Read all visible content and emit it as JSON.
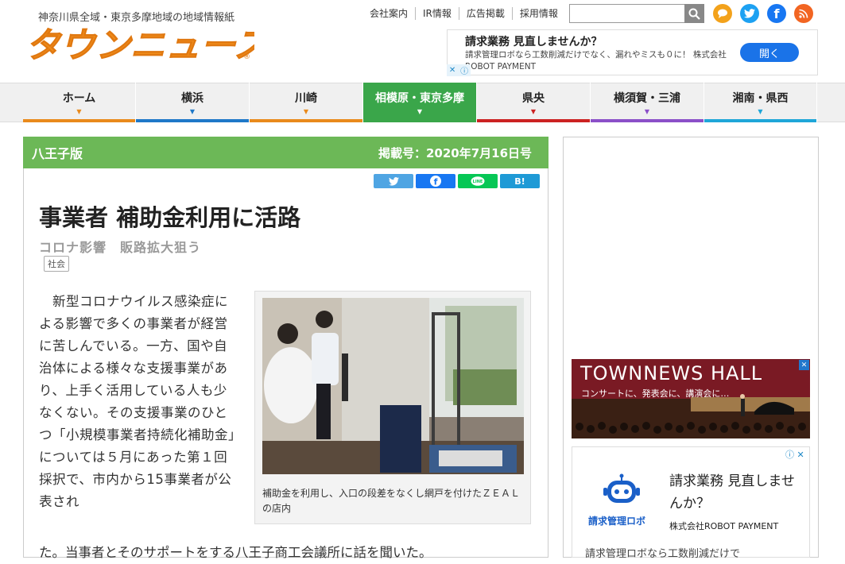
{
  "header": {
    "tagline": "神奈川県全域・東京多摩地域の地域情報紙",
    "logo_text": "タウンニュース",
    "links": [
      "会社案内",
      "IR情報",
      "広告掲載",
      "採用情報"
    ],
    "search_placeholder": "",
    "social_icons": [
      "townnews-icon",
      "twitter-icon",
      "facebook-icon",
      "rss-icon"
    ]
  },
  "top_ad": {
    "headline": "請求業務 見直しませんか？",
    "desc": "請求管理ロボなら工数削減だけでなく、漏れやミスも０に！ 株式会社ROBOT PAYMENT",
    "button": "開く"
  },
  "nav": {
    "items": [
      {
        "label": "ホーム",
        "color": "#e98a1c"
      },
      {
        "label": "横浜",
        "color": "#1f78c8"
      },
      {
        "label": "川崎",
        "color": "#e98a1c"
      },
      {
        "label": "相模原・東京多摩",
        "color": "#3aa64a"
      },
      {
        "label": "県央",
        "color": "#cc2222"
      },
      {
        "label": "横須賀・三浦",
        "color": "#8b4fc8"
      },
      {
        "label": "湘南・県西",
        "color": "#1fa6d8"
      }
    ]
  },
  "article": {
    "edition": "八王子版",
    "date": "掲載号：2020年7月16日号",
    "share_buttons": [
      "twitter-share",
      "facebook-share",
      "line-share",
      "hatena-share"
    ],
    "hatena_label": "B!",
    "line_label": "LINE",
    "headline": "事業者 補助金利用に活路",
    "subhead": "コロナ影響　販路拡大狙う",
    "tag": "社会",
    "body": "　新型コロナウイルス感染症による影響で多くの事業者が経営に苦しんでいる。一方、国や自治体による様々な支援事業があり、上手く活用している人も少なくない。その支援事業のひとつ「小規模事業者持続化補助金」については５月にあった第１回採択で、市内から15事業者が公表され",
    "body_tail": "た。当事者とそのサポートをする八王子商工会議所に話を聞いた。",
    "caption": "補助金を利用し、入口の段差をなくし網戸を付けたＺＥＡＬの店内"
  },
  "sidebar": {
    "hall_title": "TOWNNEWS HALL",
    "hall_sub": "コンサートに、発表会に、講演会に…",
    "ad2_headline": "請求業務 見直しませんか？",
    "ad2_company": "株式会社ROBOT PAYMENT",
    "ad2_logo": "請求管理ロボ",
    "ad2_desc": "請求管理ロボなら工数削減だけで"
  }
}
